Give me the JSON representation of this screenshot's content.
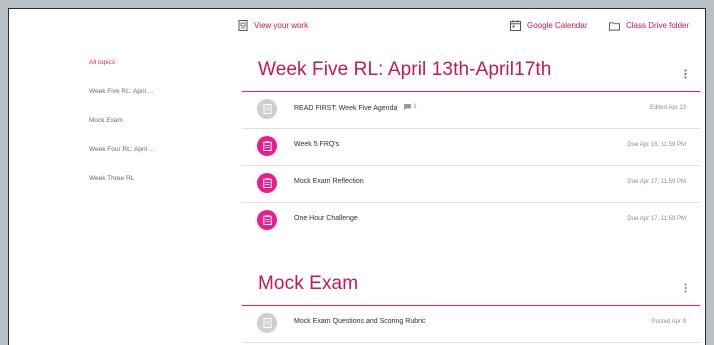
{
  "topbar": {
    "view_work": "View your work",
    "calendar": "Google Calendar",
    "drive": "Class Drive folder"
  },
  "sidebar": {
    "items": [
      {
        "label": "All topics",
        "active": true
      },
      {
        "label": "Week Five RL: April ..."
      },
      {
        "label": "Mock Exam"
      },
      {
        "label": "Week Four RL: April ..."
      },
      {
        "label": "Week Three RL"
      }
    ]
  },
  "sections": [
    {
      "title": "Week Five RL: April 13th-April17th",
      "items": [
        {
          "title": "READ FIRST: Week Five Agenda",
          "comment_count": "1",
          "due": "Edited Apr 13",
          "icon": "material-icon"
        },
        {
          "title": "Week 5 FRQ's",
          "due": "Due Apr 16, 11:59 PM",
          "icon": "assignment-icon"
        },
        {
          "title": "Mock Exam Reflection",
          "due": "Due Apr 17, 11:59 PM",
          "icon": "assignment-icon"
        },
        {
          "title": "One Hour Challenge",
          "due": "Due Apr 17, 11:59 PM",
          "icon": "assignment-icon"
        }
      ]
    },
    {
      "title": "Mock Exam",
      "items": [
        {
          "title": "Mock Exam Questions and Scoring Rubric",
          "due": "Posted Apr 9",
          "icon": "material-icon"
        }
      ]
    }
  ],
  "colors": {
    "accent": "#e91e63",
    "accent_dark": "#c2185b",
    "icon_pink": "#e91e8c",
    "icon_grey": "#cfcfcf"
  }
}
